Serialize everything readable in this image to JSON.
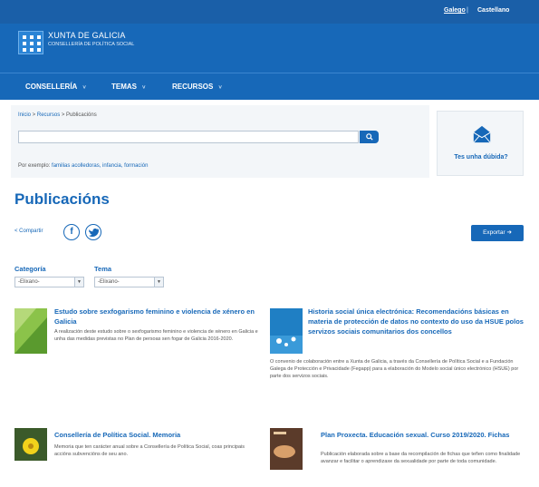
{
  "topbar": {
    "lang_gl": "Galego",
    "lang_sep": "|",
    "lang_es": "Castellano"
  },
  "header": {
    "logo_title": "XUNTA DE GALICIA",
    "logo_sub": "CONSELLERÍA DE POLÍTICA SOCIAL"
  },
  "nav": {
    "items": [
      {
        "label": "CONSELLERÍA"
      },
      {
        "label": "TEMAS"
      },
      {
        "label": "RECURSOS"
      }
    ],
    "chevron": "˅"
  },
  "search": {
    "breadcrumb": {
      "home": "Inicio",
      "sep": " > ",
      "resources": "Recursos",
      "current": "Publicacións"
    },
    "placeholder": "",
    "button_icon": "search-icon",
    "examples_prefix": "Por exemplo: ",
    "examples": "familias acolledoras, infancia, formación"
  },
  "help": {
    "label": "Tes unha dúbida?",
    "icon": "envelope-icon"
  },
  "page": {
    "title": "Publicacións",
    "share_label": "< Compartir",
    "export_label": "Exportar ➔"
  },
  "filters": {
    "category_label": "Categoría",
    "category_value": "-Elixano-",
    "theme_label": "Tema",
    "theme_value": "-Elixano-"
  },
  "publications": [
    {
      "title": "Estudo sobre sexfogarismo feminino e violencia de xénero en Galicia",
      "description": "A realización deste estudo sobre o sexfogarismo feminino e violencia de xénero en Galicia e unha das medidas previstas no Plan de persoas sen fogar de Galicia 2016-2020."
    },
    {
      "title": "Historia social única electrónica: Recomendacións básicas en materia de protección de datos no contexto do uso da HSUE polos servizos sociais comunitarios dos concellos",
      "description": "O convenio de colaboración entre a Xunta de Galicia, a través da Consellería de Política Social e a Fundación Galega de Protección e Privacidade (Fegapp) para a elaboración do Modelo social único electrónico (HSUE) por parte dos servizos sociais."
    },
    {
      "title": "Consellería de Política Social. Memoria",
      "description": "Memoria que ten carácter anual sobre a Consellería de Política Social, coas principais accións subvencións de seu ano."
    },
    {
      "title": "Plan Proxecta. Educación sexual. Curso 2019/2020. Fichas",
      "description": "Publicación elaborada sobre a base da recompilación de fichas que teñen como finalidade avanzar e facilitar o aprendizaxe da sexualidade por parte de toda comunidade."
    }
  ],
  "colors": {
    "brand": "#1768b8",
    "topbar": "#1a5fa8",
    "panel": "#f3f6f9"
  }
}
